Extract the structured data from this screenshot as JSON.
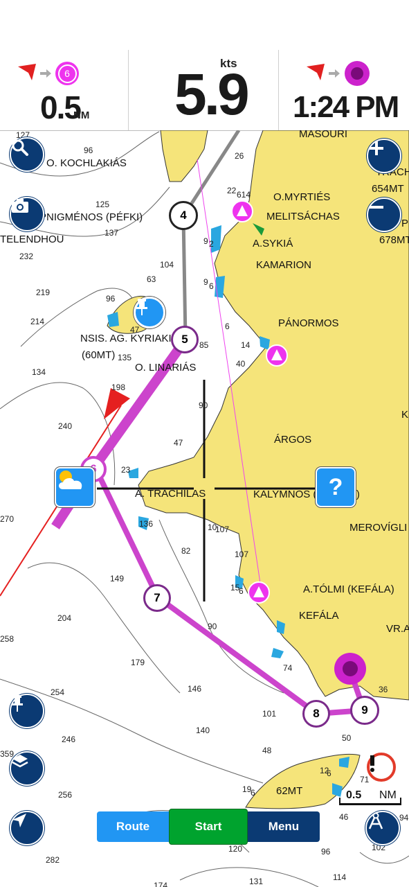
{
  "header": {
    "distance_value": "0.5",
    "distance_unit": "NM",
    "distance_waypoint": "6",
    "speed_value": "5.9",
    "speed_unit": "kts",
    "eta_value": "1:24 PM"
  },
  "map_labels": {
    "o_kochlakias": "O. KOCHLAKIÁS",
    "masouri": "MASOURI",
    "trach": "TRACH",
    "mt654": "654MT",
    "pnigmenos": "PNIGMÉNOS (PÉFKI)",
    "o_myrties": "O.MYRTIÉS",
    "melitsachas": "MELITSÁCHAS",
    "p_edge": "P",
    "mt678": "678MT",
    "telendhou": "TELENDHOU",
    "a_sykia": "A.SYKIÁ",
    "kamarion": "KAMARION",
    "panormos": "PÁNORMOS",
    "nsis_ag": "NSIS. AG. KYRIAKI",
    "mt60": "(60MT)",
    "o_linarias": "O. LINARIÁS",
    "k_edge": "K",
    "argos": "ÁRGOS",
    "a_trachilas": "A. TRACHILAS",
    "kalymnos": "KALYMNOS (KEFÁLA)",
    "merovigli": "MEROVÍGLI",
    "a_tolmi": "A.TÓLMI (KEFÁLA)",
    "kefala": "KEFÁLA",
    "vr_a": "VR.A",
    "mt62": "62MT"
  },
  "depths": [
    "127",
    "96",
    "26",
    "22",
    "614",
    "125",
    "137",
    "232",
    "9",
    "2",
    "104",
    "63",
    "9",
    "6",
    "219",
    "96",
    "214",
    "47",
    "6",
    "14",
    "135",
    "85",
    "40",
    "134",
    "198",
    "90",
    "240",
    "47",
    "23",
    "270",
    "10",
    "107",
    "82",
    "107",
    "136",
    "149",
    "15",
    "6",
    "204",
    "90",
    "258",
    "179",
    "74",
    "146",
    "254",
    "101",
    "140",
    "50",
    "36",
    "246",
    "48",
    "71",
    "359",
    "12",
    "6",
    "256",
    "19",
    "6",
    "46",
    "94",
    "102",
    "120",
    "96",
    "282",
    "114",
    "131",
    "174"
  ],
  "waypoints": [
    "4",
    "5",
    "6",
    "7",
    "8",
    "9"
  ],
  "scale": {
    "value": "0.5",
    "unit": "NM"
  },
  "bottom_bar": {
    "route": "Route",
    "start": "Start",
    "menu": "Menu"
  },
  "help_glyph": "?",
  "colors": {
    "land": "#f5e47a",
    "shallow": "#2aa7e0",
    "route": "#cc44cc",
    "route_track": "#888888",
    "button": "#0b3a73",
    "start_green": "#00a32e",
    "route_blue": "#2196f3",
    "alert_red": "#e23b2a",
    "destination": "#cc22cc"
  }
}
